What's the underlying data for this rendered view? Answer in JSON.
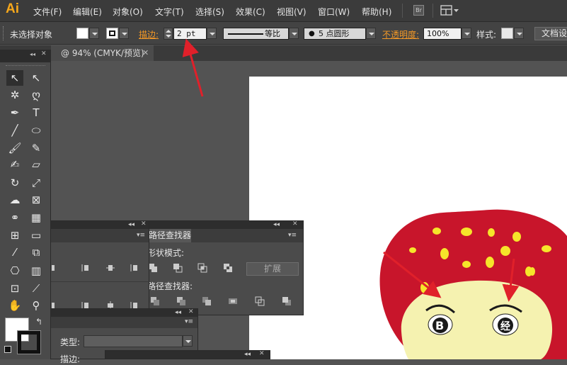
{
  "app": {
    "logo": "Ai",
    "br_label": "Br"
  },
  "menu": [
    "文件(F)",
    "编辑(E)",
    "对象(O)",
    "文字(T)",
    "选择(S)",
    "效果(C)",
    "视图(V)",
    "窗口(W)",
    "帮助(H)"
  ],
  "control": {
    "selection_status": "未选择对象",
    "stroke_label": "描边:",
    "stroke_value": "2 pt",
    "profile_label": "等比",
    "brush_label": "5 点圆形",
    "opacity_label": "不透明度:",
    "opacity_value": "100%",
    "style_label": "样式:",
    "doc_setup": "文档设"
  },
  "document": {
    "tab_title": "@ 94% (CMYK/预览)"
  },
  "pathfinder": {
    "tab": "路径查找器",
    "shape_modes": "形状模式:",
    "pathfinders": "路径查找器:",
    "expand": "扩展"
  },
  "transparency": {
    "type_label": "类型:",
    "stroke_label": "描边:"
  },
  "icons": {
    "logo": "illustrator-logo",
    "workspace": "workspace-switcher-icon"
  },
  "colors": {
    "accent_orange": "#f39826",
    "annotation_red": "#e0202a",
    "mushroom_cap": "#c8152b",
    "mushroom_face": "#f5f2b0",
    "spots": "#f6e52a"
  }
}
